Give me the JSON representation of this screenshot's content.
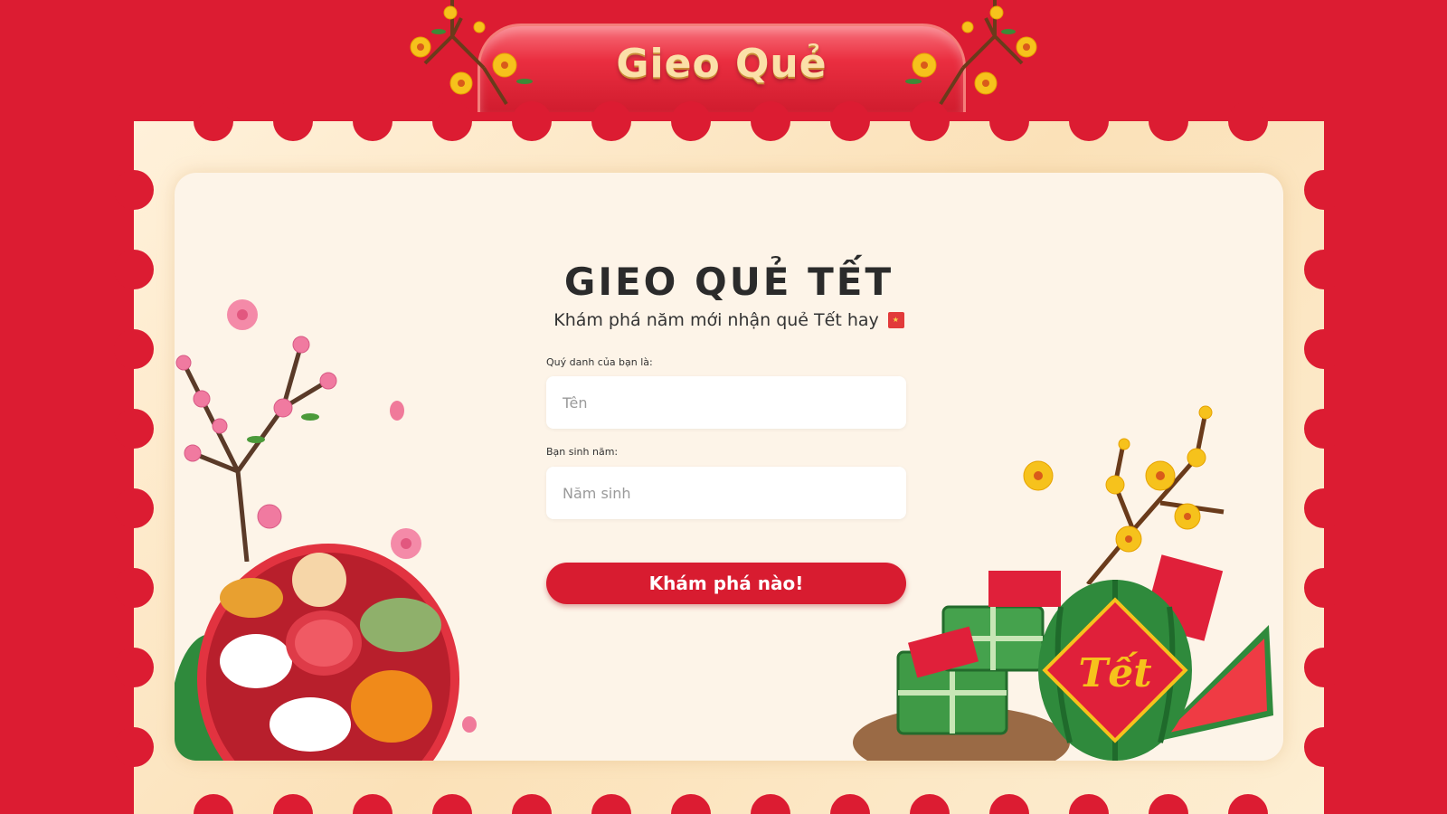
{
  "header": {
    "title": "Gieo Quẻ"
  },
  "card": {
    "title": "GIEO QUẺ TẾT",
    "subtitle": "Khám phá năm mới nhận quẻ Tết hay",
    "subtitle_icon": "vietnam-flag-icon"
  },
  "form": {
    "name_label": "Quý danh của bạn là:",
    "name_placeholder": "Tên",
    "name_value": "",
    "year_label": "Bạn sinh năm:",
    "year_placeholder": "Năm sinh",
    "year_value": "",
    "submit_label": "Khám phá nào!"
  },
  "decorations": {
    "watermelon_text": "Tết"
  },
  "colors": {
    "background": "#dc1c32",
    "accent": "#d81c30",
    "stamp": "#fbe1b8",
    "card": "#fdf4e8",
    "banner_text": "#fbe0a8"
  }
}
